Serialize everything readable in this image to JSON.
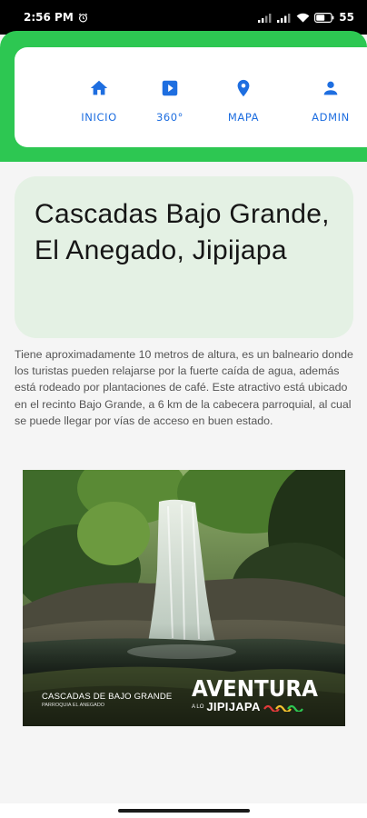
{
  "status_bar": {
    "time": "2:56 PM",
    "alarm_icon": "alarm-icon",
    "signal_icons": [
      "signal-icon",
      "signal-icon"
    ],
    "wifi_icon": "wifi-icon",
    "battery": "55"
  },
  "nav": {
    "items": [
      {
        "label": "INICIO",
        "icon": "home-icon"
      },
      {
        "label": "360°",
        "icon": "video-icon"
      },
      {
        "label": "MAPA",
        "icon": "map-pin-icon"
      },
      {
        "label": "ADMIN",
        "icon": "person-icon"
      }
    ]
  },
  "colors": {
    "accent_green": "#2dc752",
    "nav_blue": "#1e6ee0",
    "title_card_bg": "#e4f1e4"
  },
  "page": {
    "title": "Cascadas Bajo Grande, El Anegado, Jipijapa",
    "description": "Tiene aproximadamente 10 metros de altura, es un balneario donde los turistas pueden relajarse por la fuerte caída de agua, además está rodeado por plantaciones de café. Este atractivo está ubicado en el recinto Bajo Grande, a 6 km de la cabecera parroquial, al cual se puede llegar por vías de acceso en buen estado."
  },
  "photo": {
    "caption": "CASCADAS DE BAJO GRANDE",
    "subcaption": "PARROQUIA EL ANEGADO",
    "brand_main": "AVENTURA",
    "brand_small": "A LO",
    "brand_place": "JIPIJAPA"
  }
}
